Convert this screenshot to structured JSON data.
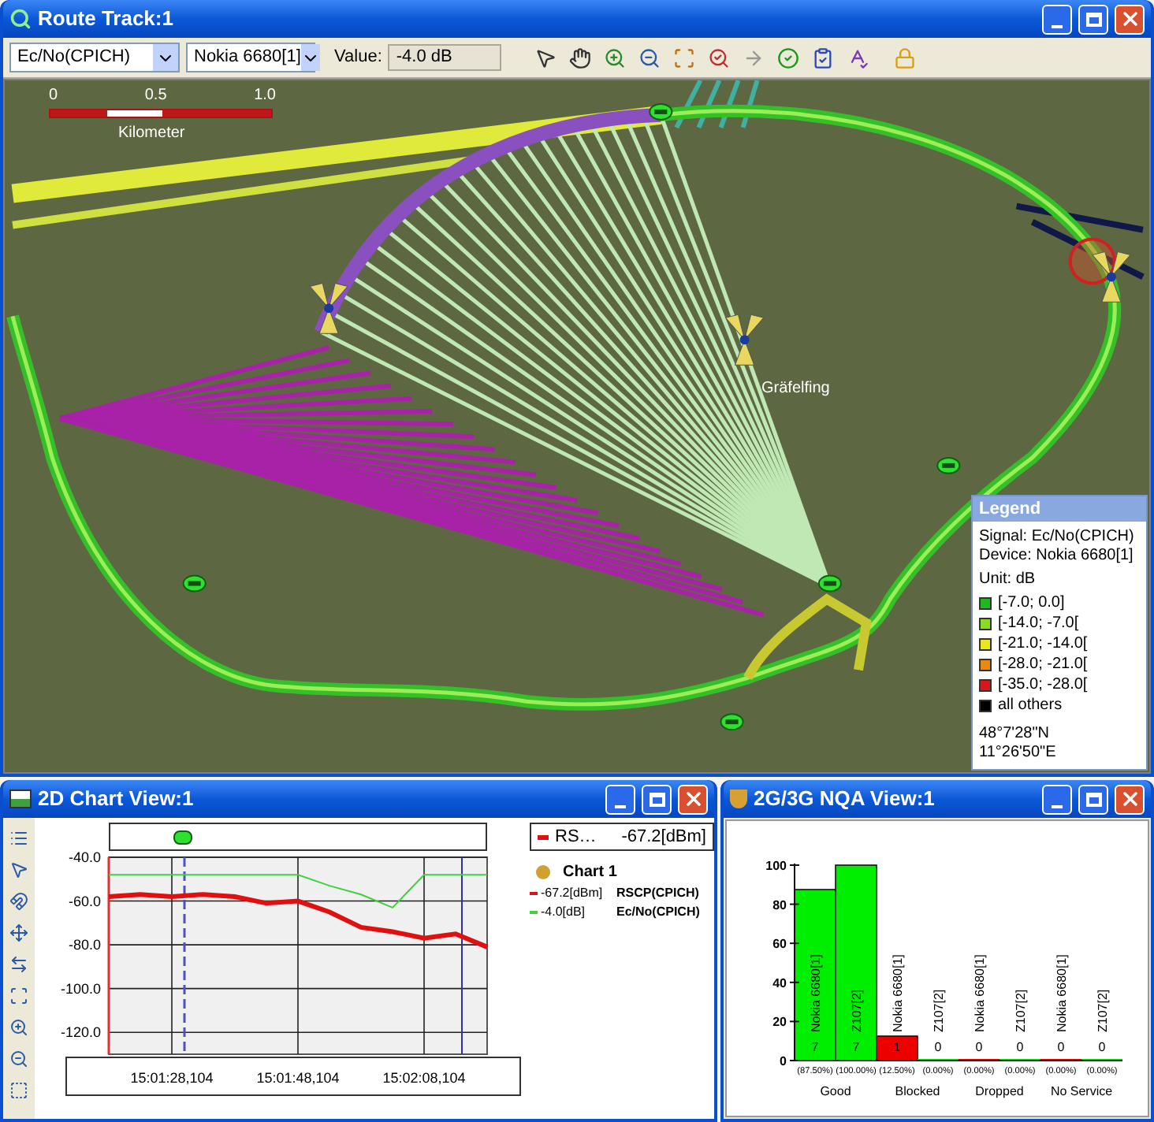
{
  "route_track": {
    "title": "Route Track:1",
    "toolbar": {
      "signal_select": "Ec/No(CPICH)",
      "device_select": "Nokia 6680[1]",
      "value_label": "Value:",
      "value": "-4.0 dB"
    },
    "map": {
      "scale_labels": [
        "0",
        "0.5",
        "1.0"
      ],
      "scale_unit": "Kilometer",
      "place_label": "Gräfelfing",
      "legend": {
        "title": "Legend",
        "signal": "Signal: Ec/No(CPICH)",
        "device": "Device: Nokia 6680[1]",
        "unit": "Unit: dB",
        "ranges": [
          {
            "label": "[-7.0; 0.0]",
            "color": "#22b522"
          },
          {
            "label": "[-14.0; -7.0[",
            "color": "#88dd22"
          },
          {
            "label": "[-21.0; -14.0[",
            "color": "#e8e820"
          },
          {
            "label": "[-28.0; -21.0[",
            "color": "#e88a10"
          },
          {
            "label": "[-35.0; -28.0[",
            "color": "#d81818"
          },
          {
            "label": "all others",
            "color": "#000000"
          }
        ],
        "latitude": "48°7'28\"N",
        "longitude": "11°26'50\"E"
      }
    }
  },
  "chart_view": {
    "title": "2D Chart View:1",
    "legend": {
      "header_name": "RS…",
      "header_value": "-67.2[dBm]",
      "chart_name": "Chart 1",
      "rows": [
        {
          "value": "-67.2[dBm]"
        },
        {
          "value": "-4.0[dB]"
        }
      ]
    },
    "chart_data": {
      "type": "line",
      "grid": true,
      "categories": [
        null,
        null,
        "15:01:28,104",
        null,
        null,
        null,
        "15:01:48,104",
        null,
        null,
        null,
        "15:02:08,104",
        null,
        null
      ],
      "ylim": [
        -130,
        -40
      ],
      "yticks": [
        {
          "value": -40,
          "label": "-40.0"
        },
        {
          "value": -60,
          "label": "-60.0"
        },
        {
          "value": -80,
          "label": "-80.0"
        },
        {
          "value": -100,
          "label": "-100.0"
        },
        {
          "value": -120,
          "label": "-120.0"
        }
      ],
      "series": [
        {
          "name": "RSCP(CPICH)",
          "color": "#e01010",
          "values": [
            -58,
            -57,
            -58,
            -57,
            -58,
            -61,
            -60,
            -65,
            -72,
            -74,
            -77,
            -75,
            -81
          ]
        },
        {
          "name": "Ec/No(CPICH)",
          "color": "#40d040",
          "values": [
            -48,
            -48,
            -48,
            -48,
            -48,
            -48,
            -48,
            -53,
            -57,
            -63,
            -48,
            -48,
            -48
          ]
        }
      ]
    }
  },
  "nqa_view": {
    "title": "2G/3G NQA View:1",
    "chart_data": {
      "type": "bar",
      "categories": [
        "Good",
        "Blocked",
        "Dropped",
        "No Service"
      ],
      "ylim": [
        0,
        100
      ],
      "yticks": [
        0,
        20,
        40,
        60,
        80,
        100
      ],
      "series": [
        {
          "name": "Nokia 6680[1]",
          "colors": [
            "#00ee00",
            "#ee0000",
            "#ee0000",
            "#ee0000"
          ],
          "values": [
            87.5,
            12.5,
            0,
            0
          ],
          "value_labels": [
            "(87.50%)",
            "(12.50%)",
            "(0.00%)",
            "(0.00%)"
          ]
        },
        {
          "name": "Z107[2]",
          "color": "#00ee00",
          "values": [
            100,
            0,
            0,
            0
          ],
          "value_labels": [
            "(100.00%)",
            "(0.00%)",
            "(0.00%)",
            "(0.00%)"
          ]
        }
      ]
    },
    "bar_counts": [
      [
        "7",
        "1",
        "0",
        "0"
      ],
      [
        "7",
        "0",
        "0",
        "0"
      ]
    ]
  }
}
